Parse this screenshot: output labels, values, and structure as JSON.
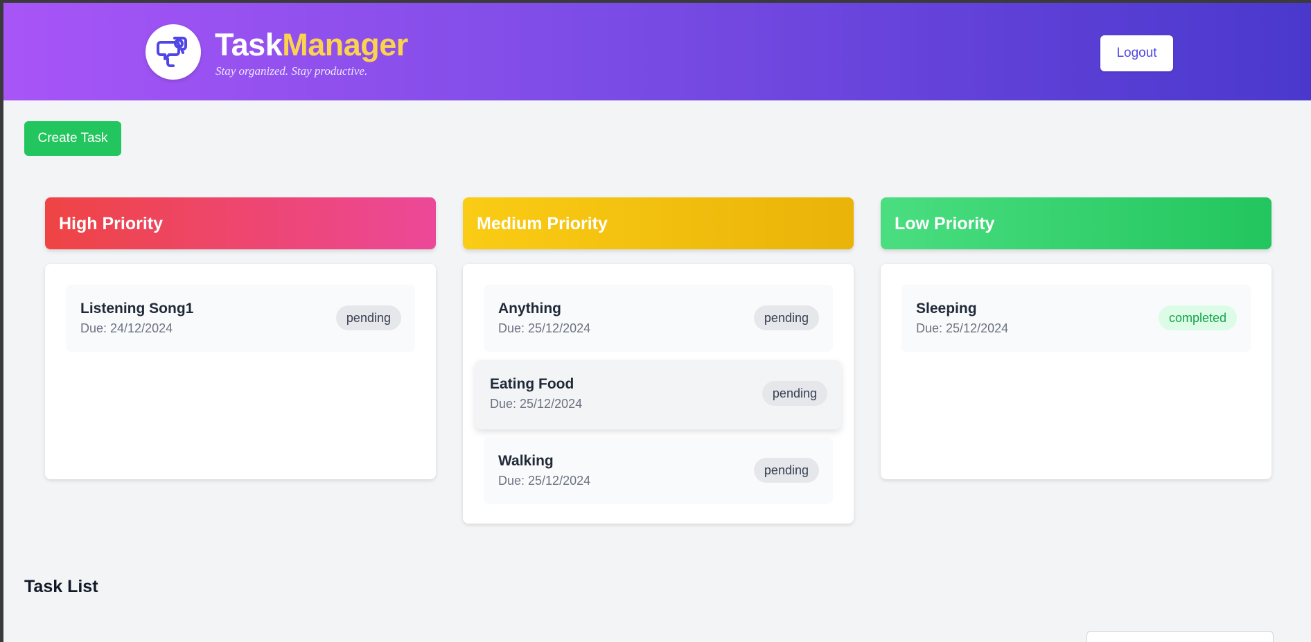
{
  "header": {
    "brand_part1": "Task",
    "brand_part2": "Manager",
    "tagline": "Stay organized. Stay productive.",
    "logo_icon": "chat-bubbles-icon",
    "logout_label": "Logout"
  },
  "toolbar": {
    "create_label": "Create Task"
  },
  "columns": [
    {
      "title": "High Priority",
      "tasks": [
        {
          "title": "Listening Song1",
          "due": "Due: 24/12/2024",
          "status": "pending"
        }
      ]
    },
    {
      "title": "Medium Priority",
      "tasks": [
        {
          "title": "Anything",
          "due": "Due: 25/12/2024",
          "status": "pending"
        },
        {
          "title": "Eating Food",
          "due": "Due: 25/12/2024",
          "status": "pending"
        },
        {
          "title": "Walking",
          "due": "Due: 25/12/2024",
          "status": "pending"
        }
      ]
    },
    {
      "title": "Low Priority",
      "tasks": [
        {
          "title": "Sleeping",
          "due": "Due: 25/12/2024",
          "status": "completed"
        }
      ]
    }
  ],
  "task_list": {
    "title": "Task List"
  },
  "colors": {
    "header_start": "#a855f7",
    "header_end": "#4a38cc",
    "brand_accent": "#fcd34d",
    "create_button": "#22c55e",
    "high": "#ef4444",
    "medium": "#facc15",
    "low": "#22c55e"
  }
}
